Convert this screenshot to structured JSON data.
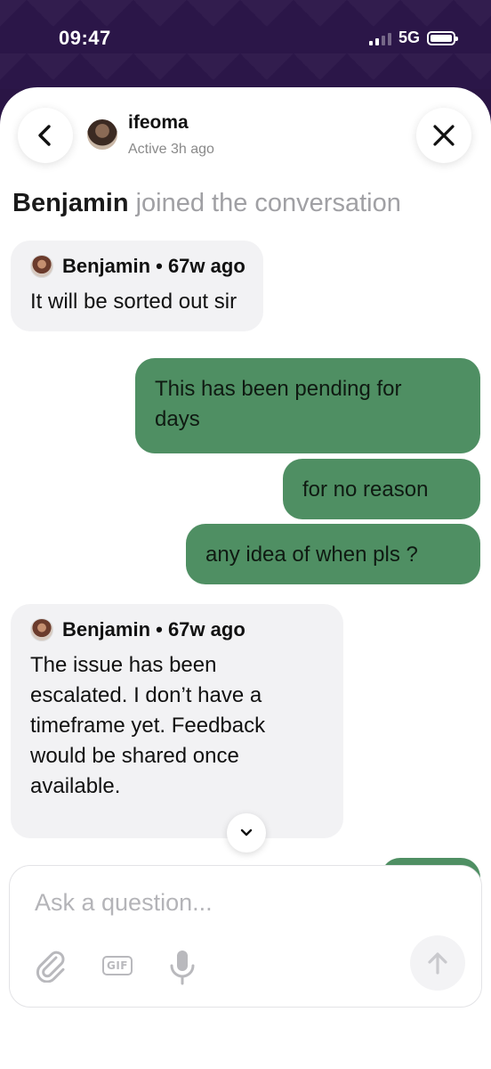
{
  "status_bar": {
    "time": "09:47",
    "network": "5G"
  },
  "header": {
    "name": "ifeoma",
    "status": "Active 3h ago"
  },
  "notice": {
    "name": "Benjamin",
    "text": " joined the conversation"
  },
  "messages": [
    {
      "direction": "in",
      "sender_meta": "Benjamin • 67w ago",
      "text": "It will be sorted out sir"
    },
    {
      "direction": "out",
      "lines": [
        "This has been pending for",
        "days"
      ]
    },
    {
      "direction": "out",
      "text": "for no reason"
    },
    {
      "direction": "out",
      "text": "any idea of when pls ?"
    },
    {
      "direction": "in",
      "sender_meta": "Benjamin • 67w ago",
      "lines": [
        "The issue has been",
        "escalated. I don’t have a",
        "timeframe yet. Feedback",
        "would be shared once",
        "available."
      ]
    }
  ],
  "composer": {
    "placeholder": "Ask a question...",
    "gif_label": "GIF"
  },
  "icons": {
    "back": "chevron-left-icon",
    "close": "close-icon",
    "scroll": "chevron-down-icon",
    "attach": "paperclip-icon",
    "gif": "gif-icon",
    "mic": "microphone-icon",
    "send": "arrow-up-icon"
  },
  "colors": {
    "outgoing_bubble": "#4f8f63",
    "incoming_bubble": "#f2f2f4",
    "status_bg": "#2b1648"
  }
}
